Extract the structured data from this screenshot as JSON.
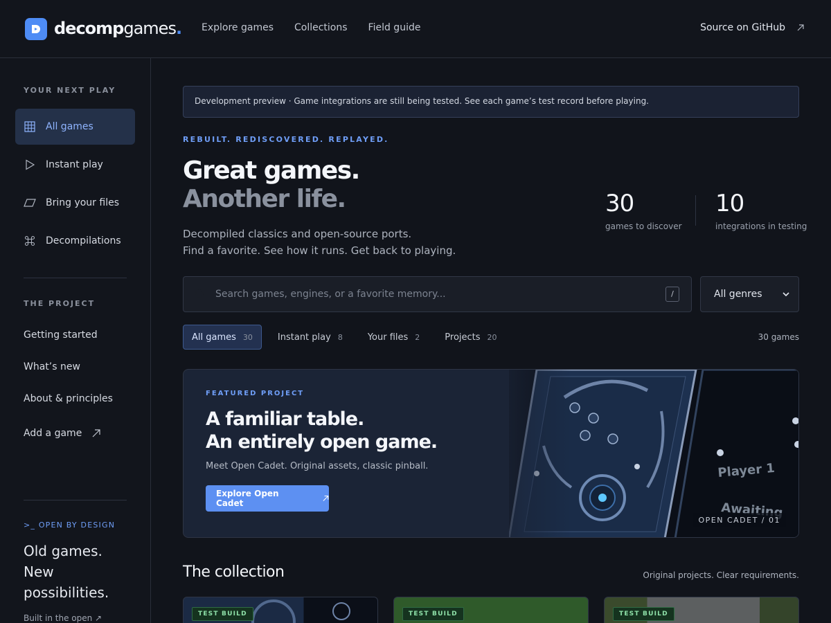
{
  "header": {
    "brand_bold": "decomp",
    "brand_light": "games",
    "brand_dot": ".",
    "nav": [
      "Explore games",
      "Collections",
      "Field guide"
    ],
    "github_label": "Source on GitHub"
  },
  "sidebar": {
    "section1_label": "YOUR NEXT PLAY",
    "items": [
      {
        "label": "All games",
        "icon": "grid-icon",
        "active": true
      },
      {
        "label": "Instant play",
        "icon": "play-icon"
      },
      {
        "label": "Bring your files",
        "icon": "file-icon"
      },
      {
        "label": "Decompilations",
        "icon": "command-icon"
      }
    ],
    "section2_label": "THE PROJECT",
    "project_links": [
      "Getting started",
      "What’s new",
      "About & principles",
      "Add a game"
    ],
    "open_label": ">_ OPEN BY DESIGN",
    "open_lines": [
      "Old games.",
      "New",
      "possibilities."
    ],
    "built_link": "Built in the open ↗"
  },
  "main": {
    "banner": "Development preview · Game integrations are still being tested. See each game’s test record before playing.",
    "eyebrow": "REBUILT. REDISCOVERED. REPLAYED.",
    "title_line1": "Great games.",
    "title_line2": "Another life.",
    "lede_line1": "Decompiled classics and open-source ports.",
    "lede_line2": "Find a favorite. See how it runs. Get back to playing.",
    "stats": [
      {
        "value": "30",
        "caption": "games to discover"
      },
      {
        "value": "10",
        "caption": "integrations in testing"
      }
    ],
    "search_placeholder": "Search games, engines, or a favorite memory...",
    "search_shortcut": "/",
    "genre_select": "All genres",
    "tabs": [
      {
        "label": "All games",
        "count": "30",
        "active": true
      },
      {
        "label": "Instant play",
        "count": "8"
      },
      {
        "label": "Your files",
        "count": "2"
      },
      {
        "label": "Projects",
        "count": "20"
      }
    ],
    "games_count": "30 games",
    "featured": {
      "eyebrow": "FEATURED PROJECT",
      "title_line1": "A familiar table.",
      "title_line2": "An entirely open game.",
      "subtitle": "Meet Open Cadet. Original assets, classic pinball.",
      "button": "Explore Open Cadet",
      "tag": "OPEN CADET / 01",
      "art_text1": "Player 1",
      "art_text2": "Awaiting"
    },
    "collection_title": "The collection",
    "collection_sub": "Original projects. Clear requirements.",
    "cards": [
      {
        "badge": "TEST BUILD"
      },
      {
        "badge": "TEST BUILD"
      },
      {
        "badge": "TEST BUILD"
      }
    ]
  },
  "colors": {
    "accent": "#4e8cf5",
    "background": "#11141b",
    "active_nav": "#243149",
    "badge_green": "#8ee0a8"
  }
}
